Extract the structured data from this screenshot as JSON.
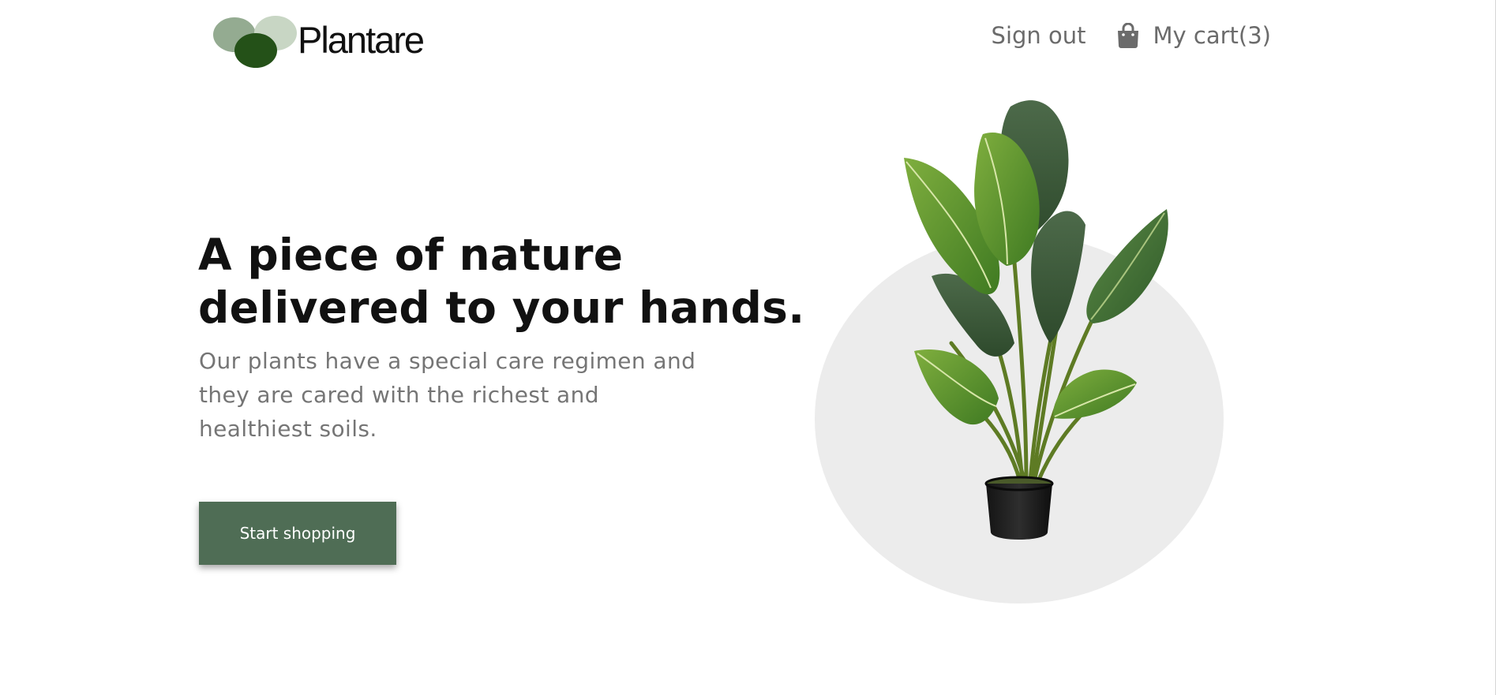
{
  "app": {
    "brand_name": "Plantare"
  },
  "header": {
    "sign_out_label": "Sign out",
    "cart_label": "My cart(3)"
  },
  "hero": {
    "title_lines": [
      "A piece of nature",
      "delivered to your hands."
    ],
    "subtitle_lines": [
      "Our plants have a special care regimen and",
      "they are cared with the richest and",
      "healthiest soils."
    ],
    "cta_label": "Start shopping"
  },
  "icons": {
    "logo": "logo-mark",
    "cart": "shopping-bag-icon",
    "illustration": "potted-plant"
  },
  "colors": {
    "brand_dark_green": "#245118",
    "brand_mid_green": "#94ab91",
    "brand_light_green": "#c8d6c4",
    "cta_background": "#4f6d55",
    "nav_text": "#6b6b6b",
    "circle_background": "#ececec"
  }
}
